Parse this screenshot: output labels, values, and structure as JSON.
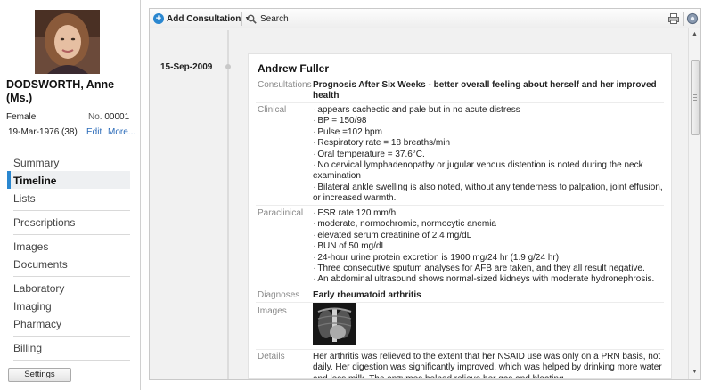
{
  "patient": {
    "name": "DODSWORTH, Anne (Ms.)",
    "gender": "Female",
    "no_label": "No.",
    "no_value": "00001",
    "dob": "19-Mar-1976 (38)",
    "edit_link": "Edit",
    "more_link": "More..."
  },
  "nav": {
    "summary": "Summary",
    "timeline": "Timeline",
    "lists": "Lists",
    "prescriptions": "Prescriptions",
    "images": "Images",
    "documents": "Documents",
    "laboratory": "Laboratory",
    "imaging": "Imaging",
    "pharmacy": "Pharmacy",
    "billing": "Billing"
  },
  "settings_label": "Settings",
  "toolbar": {
    "add_consultation": "Add Consultation",
    "search": "Search"
  },
  "timeline": {
    "date": "15-Sep-2009",
    "doctor": "Andrew Fuller",
    "labels": {
      "consultations": "Consultations",
      "clinical": "Clinical",
      "paraclinical": "Paraclinical",
      "diagnoses": "Diagnoses",
      "images": "Images",
      "details": "Details"
    },
    "consultation_title": "Prognosis After Six Weeks - better overall feeling about herself and her improved health",
    "clinical": [
      "appears cachectic and pale but in no acute distress",
      "BP = 150/98",
      "Pulse =102 bpm",
      "Respiratory rate = 18 breaths/min",
      "Oral temperature = 37.6°C.",
      "No cervical lymphadenopathy or jugular venous distention is noted during the neck examination",
      "Bilateral ankle swelling is also noted, without any tenderness to palpation, joint effusion, or increased warmth."
    ],
    "paraclinical": [
      "ESR rate 120 mm/h",
      "moderate, normochromic, normocytic anemia",
      "elevated serum creatinine of 2.4 mg/dL",
      "BUN of 50 mg/dL",
      "24-hour urine protein excretion is 1900 mg/24 hr (1.9 g/24 hr)",
      "Three consecutive sputum analyses for AFB are taken, and they all result negative.",
      "An abdominal ultrasound shows normal-sized kidneys with moderate hydronephrosis."
    ],
    "diagnosis": "Early rheumatoid arthritis",
    "details": "Her arthritis was relieved to the extent that her NSAID use was only on a PRN basis, not daily. Her digestion was significantly improved, which was helped by drinking more water and less milk. The enzymes helped relieve her gas and bloating."
  },
  "colors": {
    "accent": "#2a87d0",
    "link": "#2a6ab8"
  }
}
